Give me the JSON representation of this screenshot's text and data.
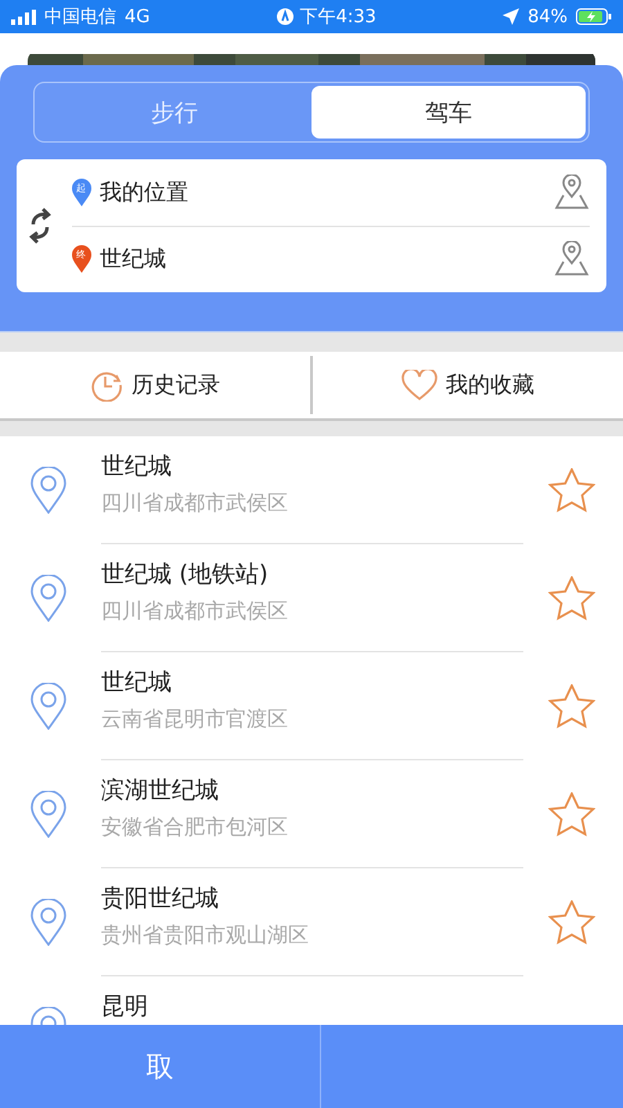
{
  "status_bar": {
    "carrier": "中国电信",
    "network": "4G",
    "time": "下午4:33",
    "battery": "84%"
  },
  "mode_tabs": [
    {
      "label": "步行",
      "selected": false
    },
    {
      "label": "驾车",
      "selected": true
    }
  ],
  "route": {
    "start": {
      "badge": "起",
      "text": "我的位置"
    },
    "end": {
      "badge": "终",
      "text": "世纪城"
    }
  },
  "shortcuts": [
    {
      "kind": "history",
      "label": "历史记录"
    },
    {
      "kind": "favorites",
      "label": "我的收藏"
    }
  ],
  "results": [
    {
      "title": "世纪城",
      "address": "四川省成都市武侯区"
    },
    {
      "title": "世纪城 (地铁站)",
      "address": "四川省成都市武侯区"
    },
    {
      "title": "世纪城",
      "address": "云南省昆明市官渡区"
    },
    {
      "title": "滨湖世纪城",
      "address": "安徽省合肥市包河区"
    },
    {
      "title": "贵阳世纪城",
      "address": "贵州省贵阳市观山湖区"
    },
    {
      "title": "昆明"
    }
  ],
  "bottom_bar": {
    "left_button": "取"
  }
}
